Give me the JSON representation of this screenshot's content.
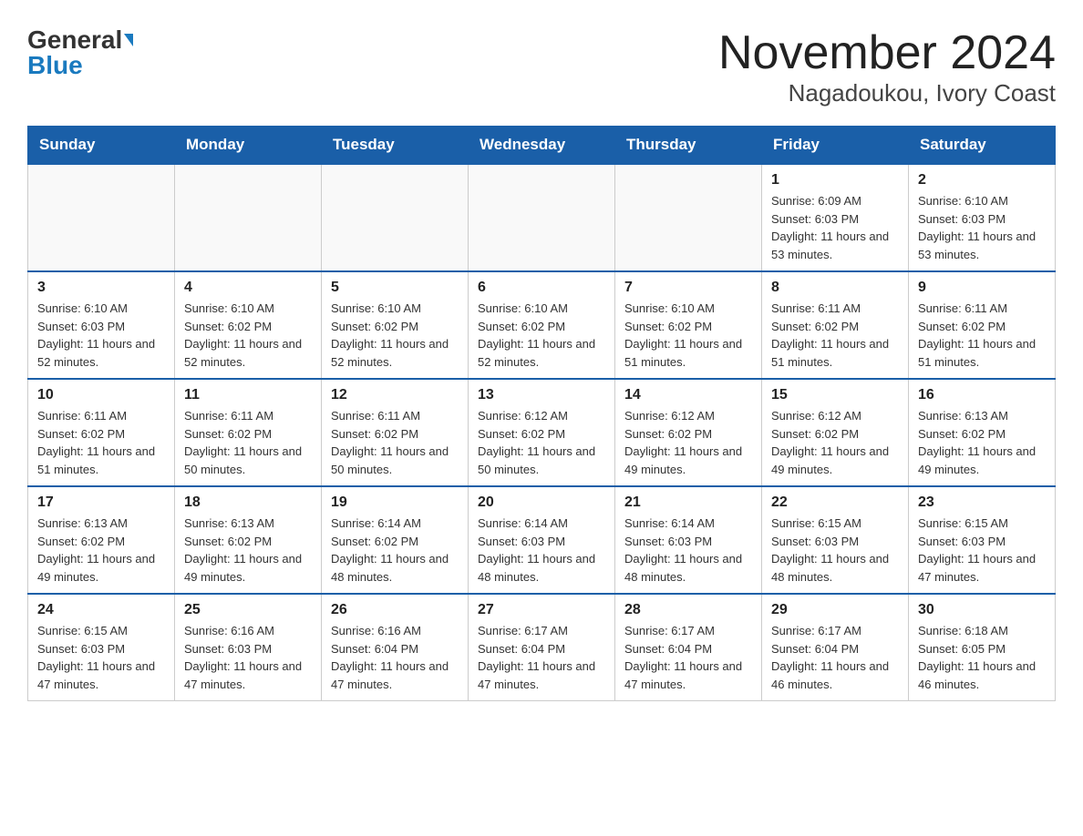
{
  "header": {
    "logo_general": "General",
    "logo_blue": "Blue",
    "month_year": "November 2024",
    "location": "Nagadoukou, Ivory Coast"
  },
  "days_of_week": [
    "Sunday",
    "Monday",
    "Tuesday",
    "Wednesday",
    "Thursday",
    "Friday",
    "Saturday"
  ],
  "weeks": [
    [
      {
        "day": "",
        "sunrise": "",
        "sunset": "",
        "daylight": ""
      },
      {
        "day": "",
        "sunrise": "",
        "sunset": "",
        "daylight": ""
      },
      {
        "day": "",
        "sunrise": "",
        "sunset": "",
        "daylight": ""
      },
      {
        "day": "",
        "sunrise": "",
        "sunset": "",
        "daylight": ""
      },
      {
        "day": "",
        "sunrise": "",
        "sunset": "",
        "daylight": ""
      },
      {
        "day": "1",
        "sunrise": "Sunrise: 6:09 AM",
        "sunset": "Sunset: 6:03 PM",
        "daylight": "Daylight: 11 hours and 53 minutes."
      },
      {
        "day": "2",
        "sunrise": "Sunrise: 6:10 AM",
        "sunset": "Sunset: 6:03 PM",
        "daylight": "Daylight: 11 hours and 53 minutes."
      }
    ],
    [
      {
        "day": "3",
        "sunrise": "Sunrise: 6:10 AM",
        "sunset": "Sunset: 6:03 PM",
        "daylight": "Daylight: 11 hours and 52 minutes."
      },
      {
        "day": "4",
        "sunrise": "Sunrise: 6:10 AM",
        "sunset": "Sunset: 6:02 PM",
        "daylight": "Daylight: 11 hours and 52 minutes."
      },
      {
        "day": "5",
        "sunrise": "Sunrise: 6:10 AM",
        "sunset": "Sunset: 6:02 PM",
        "daylight": "Daylight: 11 hours and 52 minutes."
      },
      {
        "day": "6",
        "sunrise": "Sunrise: 6:10 AM",
        "sunset": "Sunset: 6:02 PM",
        "daylight": "Daylight: 11 hours and 52 minutes."
      },
      {
        "day": "7",
        "sunrise": "Sunrise: 6:10 AM",
        "sunset": "Sunset: 6:02 PM",
        "daylight": "Daylight: 11 hours and 51 minutes."
      },
      {
        "day": "8",
        "sunrise": "Sunrise: 6:11 AM",
        "sunset": "Sunset: 6:02 PM",
        "daylight": "Daylight: 11 hours and 51 minutes."
      },
      {
        "day": "9",
        "sunrise": "Sunrise: 6:11 AM",
        "sunset": "Sunset: 6:02 PM",
        "daylight": "Daylight: 11 hours and 51 minutes."
      }
    ],
    [
      {
        "day": "10",
        "sunrise": "Sunrise: 6:11 AM",
        "sunset": "Sunset: 6:02 PM",
        "daylight": "Daylight: 11 hours and 51 minutes."
      },
      {
        "day": "11",
        "sunrise": "Sunrise: 6:11 AM",
        "sunset": "Sunset: 6:02 PM",
        "daylight": "Daylight: 11 hours and 50 minutes."
      },
      {
        "day": "12",
        "sunrise": "Sunrise: 6:11 AM",
        "sunset": "Sunset: 6:02 PM",
        "daylight": "Daylight: 11 hours and 50 minutes."
      },
      {
        "day": "13",
        "sunrise": "Sunrise: 6:12 AM",
        "sunset": "Sunset: 6:02 PM",
        "daylight": "Daylight: 11 hours and 50 minutes."
      },
      {
        "day": "14",
        "sunrise": "Sunrise: 6:12 AM",
        "sunset": "Sunset: 6:02 PM",
        "daylight": "Daylight: 11 hours and 49 minutes."
      },
      {
        "day": "15",
        "sunrise": "Sunrise: 6:12 AM",
        "sunset": "Sunset: 6:02 PM",
        "daylight": "Daylight: 11 hours and 49 minutes."
      },
      {
        "day": "16",
        "sunrise": "Sunrise: 6:13 AM",
        "sunset": "Sunset: 6:02 PM",
        "daylight": "Daylight: 11 hours and 49 minutes."
      }
    ],
    [
      {
        "day": "17",
        "sunrise": "Sunrise: 6:13 AM",
        "sunset": "Sunset: 6:02 PM",
        "daylight": "Daylight: 11 hours and 49 minutes."
      },
      {
        "day": "18",
        "sunrise": "Sunrise: 6:13 AM",
        "sunset": "Sunset: 6:02 PM",
        "daylight": "Daylight: 11 hours and 49 minutes."
      },
      {
        "day": "19",
        "sunrise": "Sunrise: 6:14 AM",
        "sunset": "Sunset: 6:02 PM",
        "daylight": "Daylight: 11 hours and 48 minutes."
      },
      {
        "day": "20",
        "sunrise": "Sunrise: 6:14 AM",
        "sunset": "Sunset: 6:03 PM",
        "daylight": "Daylight: 11 hours and 48 minutes."
      },
      {
        "day": "21",
        "sunrise": "Sunrise: 6:14 AM",
        "sunset": "Sunset: 6:03 PM",
        "daylight": "Daylight: 11 hours and 48 minutes."
      },
      {
        "day": "22",
        "sunrise": "Sunrise: 6:15 AM",
        "sunset": "Sunset: 6:03 PM",
        "daylight": "Daylight: 11 hours and 48 minutes."
      },
      {
        "day": "23",
        "sunrise": "Sunrise: 6:15 AM",
        "sunset": "Sunset: 6:03 PM",
        "daylight": "Daylight: 11 hours and 47 minutes."
      }
    ],
    [
      {
        "day": "24",
        "sunrise": "Sunrise: 6:15 AM",
        "sunset": "Sunset: 6:03 PM",
        "daylight": "Daylight: 11 hours and 47 minutes."
      },
      {
        "day": "25",
        "sunrise": "Sunrise: 6:16 AM",
        "sunset": "Sunset: 6:03 PM",
        "daylight": "Daylight: 11 hours and 47 minutes."
      },
      {
        "day": "26",
        "sunrise": "Sunrise: 6:16 AM",
        "sunset": "Sunset: 6:04 PM",
        "daylight": "Daylight: 11 hours and 47 minutes."
      },
      {
        "day": "27",
        "sunrise": "Sunrise: 6:17 AM",
        "sunset": "Sunset: 6:04 PM",
        "daylight": "Daylight: 11 hours and 47 minutes."
      },
      {
        "day": "28",
        "sunrise": "Sunrise: 6:17 AM",
        "sunset": "Sunset: 6:04 PM",
        "daylight": "Daylight: 11 hours and 47 minutes."
      },
      {
        "day": "29",
        "sunrise": "Sunrise: 6:17 AM",
        "sunset": "Sunset: 6:04 PM",
        "daylight": "Daylight: 11 hours and 46 minutes."
      },
      {
        "day": "30",
        "sunrise": "Sunrise: 6:18 AM",
        "sunset": "Sunset: 6:05 PM",
        "daylight": "Daylight: 11 hours and 46 minutes."
      }
    ]
  ]
}
